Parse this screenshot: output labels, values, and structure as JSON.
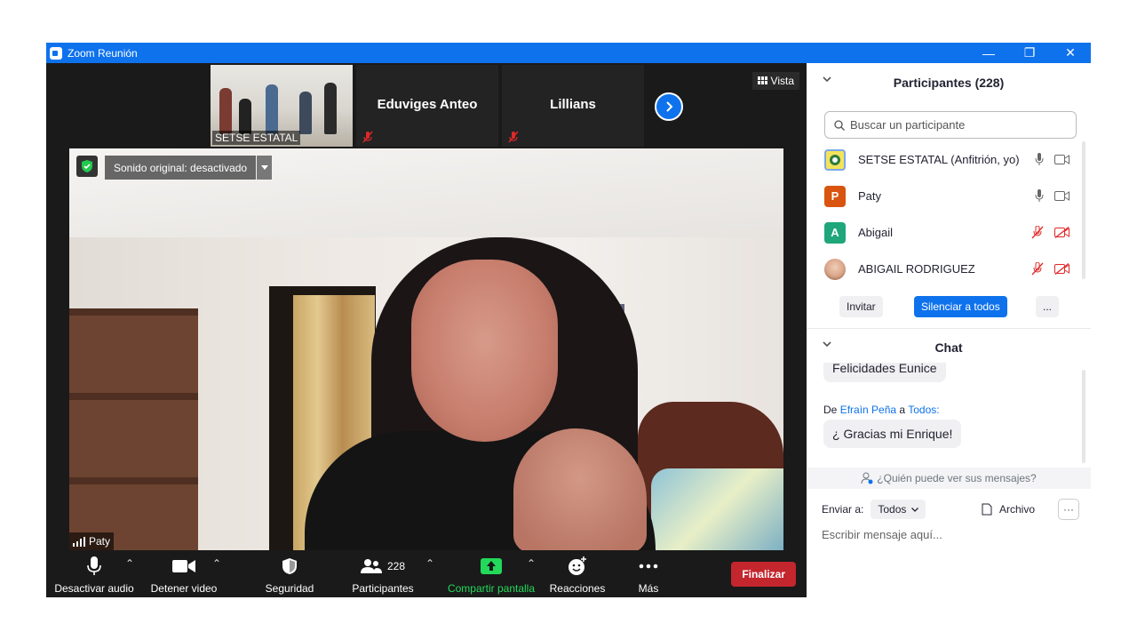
{
  "window": {
    "title": "Zoom Reunión"
  },
  "gallery": {
    "thumbs": [
      {
        "name": "SETSE ESTATAL"
      },
      {
        "name": "Eduviges Anteo"
      },
      {
        "name": "Lillians"
      }
    ],
    "view_label": "Vista"
  },
  "main_video": {
    "sound_status": "Sonido original: desactivado",
    "speaker_name": "Paty"
  },
  "toolbar": {
    "mute_label": "Desactivar audio",
    "video_label": "Detener video",
    "security_label": "Seguridad",
    "participants_label": "Participantes",
    "participants_count": "228",
    "share_label": "Compartir pantalla",
    "reactions_label": "Reacciones",
    "more_label": "Más",
    "end_label": "Finalizar"
  },
  "participants_panel": {
    "title": "Participantes (228)",
    "search_placeholder": "Buscar un participante",
    "items": [
      {
        "name": "SETSE ESTATAL (Anfitrión, yo)",
        "initial": "",
        "color": "#f2e35a",
        "muted": false
      },
      {
        "name": "Paty",
        "initial": "P",
        "color": "#d9540f",
        "muted": false
      },
      {
        "name": "Abigail",
        "initial": "A",
        "color": "#1fa67a",
        "muted": true
      },
      {
        "name": "ABIGAIL RODRIGUEZ",
        "initial": "",
        "color": "#d8a48a",
        "muted": true
      }
    ],
    "invite_label": "Invitar",
    "mute_all_label": "Silenciar a todos",
    "more_label": "..."
  },
  "chat_panel": {
    "title": "Chat",
    "messages": [
      {
        "text": "Felicidades Eunice"
      },
      {
        "from_prefix": "De",
        "from": "Efraìn Peña",
        "to_prefix": "a",
        "to": "Todos:",
        "text": "¿ Gracias mi Enrique!"
      }
    ],
    "who_sees": "¿Quién puede ver sus mensajes?",
    "send_to_label": "Enviar a:",
    "send_to_value": "Todos",
    "file_label": "Archivo",
    "more_label": "···",
    "input_placeholder": "Escribir mensaje aquí..."
  },
  "colors": {
    "accent": "#0e72ed",
    "end_button": "#c4262e",
    "share_green": "#23d959",
    "muted_red": "#e02828"
  }
}
